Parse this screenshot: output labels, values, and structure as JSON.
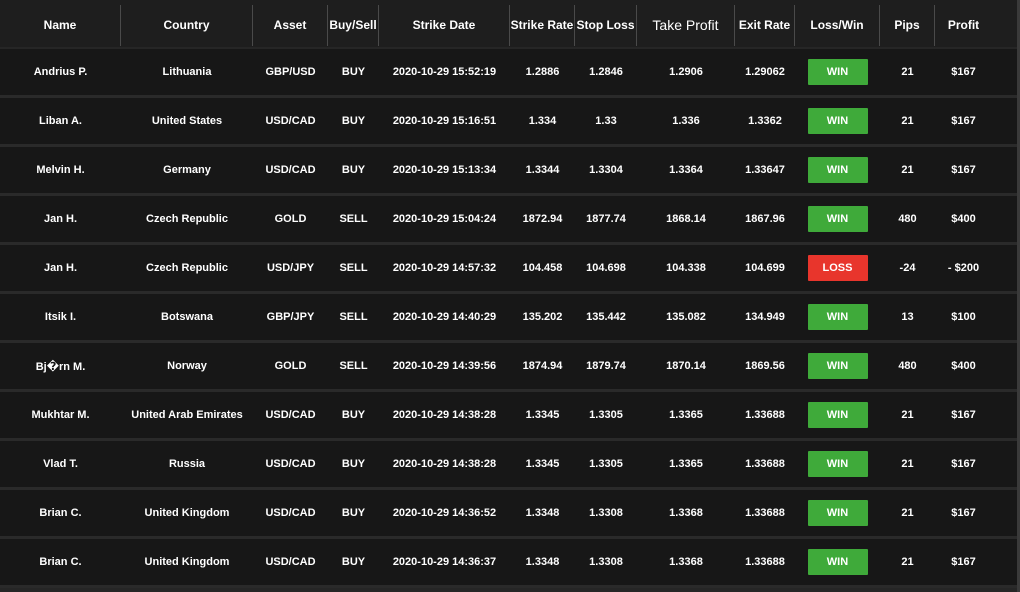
{
  "colors": {
    "win": "#3faa3a",
    "loss": "#e8352c",
    "background": "#171717",
    "header": "#1e1e1e"
  },
  "columns": [
    "Name",
    "Country",
    "Asset",
    "Buy/Sell",
    "Strike Date",
    "Strike Rate",
    "Stop Loss",
    "Take Profit",
    "Exit Rate",
    "Loss/Win",
    "Pips",
    "Profit"
  ],
  "rows": [
    {
      "name": "Andrius P.",
      "country": "Lithuania",
      "asset": "GBP/USD",
      "side": "BUY",
      "date": "2020-10-29 15:52:19",
      "strike": "1.2886",
      "stop": "1.2846",
      "take": "1.2906",
      "exit": "1.29062",
      "result": "WIN",
      "pips": "21",
      "profit": "$167"
    },
    {
      "name": "Liban A.",
      "country": "United States",
      "asset": "USD/CAD",
      "side": "BUY",
      "date": "2020-10-29 15:16:51",
      "strike": "1.334",
      "stop": "1.33",
      "take": "1.336",
      "exit": "1.3362",
      "result": "WIN",
      "pips": "21",
      "profit": "$167"
    },
    {
      "name": "Melvin H.",
      "country": "Germany",
      "asset": "USD/CAD",
      "side": "BUY",
      "date": "2020-10-29 15:13:34",
      "strike": "1.3344",
      "stop": "1.3304",
      "take": "1.3364",
      "exit": "1.33647",
      "result": "WIN",
      "pips": "21",
      "profit": "$167"
    },
    {
      "name": "Jan H.",
      "country": "Czech Republic",
      "asset": "GOLD",
      "side": "SELL",
      "date": "2020-10-29 15:04:24",
      "strike": "1872.94",
      "stop": "1877.74",
      "take": "1868.14",
      "exit": "1867.96",
      "result": "WIN",
      "pips": "480",
      "profit": "$400"
    },
    {
      "name": "Jan H.",
      "country": "Czech Republic",
      "asset": "USD/JPY",
      "side": "SELL",
      "date": "2020-10-29 14:57:32",
      "strike": "104.458",
      "stop": "104.698",
      "take": "104.338",
      "exit": "104.699",
      "result": "LOSS",
      "pips": "-24",
      "profit": "- $200"
    },
    {
      "name": "Itsik I.",
      "country": "Botswana",
      "asset": "GBP/JPY",
      "side": "SELL",
      "date": "2020-10-29 14:40:29",
      "strike": "135.202",
      "stop": "135.442",
      "take": "135.082",
      "exit": "134.949",
      "result": "WIN",
      "pips": "13",
      "profit": "$100"
    },
    {
      "name": "Bj�rn M.",
      "country": "Norway",
      "asset": "GOLD",
      "side": "SELL",
      "date": "2020-10-29 14:39:56",
      "strike": "1874.94",
      "stop": "1879.74",
      "take": "1870.14",
      "exit": "1869.56",
      "result": "WIN",
      "pips": "480",
      "profit": "$400"
    },
    {
      "name": "Mukhtar M.",
      "country": "United Arab Emirates",
      "asset": "USD/CAD",
      "side": "BUY",
      "date": "2020-10-29 14:38:28",
      "strike": "1.3345",
      "stop": "1.3305",
      "take": "1.3365",
      "exit": "1.33688",
      "result": "WIN",
      "pips": "21",
      "profit": "$167"
    },
    {
      "name": "Vlad T.",
      "country": "Russia",
      "asset": "USD/CAD",
      "side": "BUY",
      "date": "2020-10-29 14:38:28",
      "strike": "1.3345",
      "stop": "1.3305",
      "take": "1.3365",
      "exit": "1.33688",
      "result": "WIN",
      "pips": "21",
      "profit": "$167"
    },
    {
      "name": "Brian C.",
      "country": "United Kingdom",
      "asset": "USD/CAD",
      "side": "BUY",
      "date": "2020-10-29 14:36:52",
      "strike": "1.3348",
      "stop": "1.3308",
      "take": "1.3368",
      "exit": "1.33688",
      "result": "WIN",
      "pips": "21",
      "profit": "$167"
    },
    {
      "name": "Brian C.",
      "country": "United Kingdom",
      "asset": "USD/CAD",
      "side": "BUY",
      "date": "2020-10-29 14:36:37",
      "strike": "1.3348",
      "stop": "1.3308",
      "take": "1.3368",
      "exit": "1.33688",
      "result": "WIN",
      "pips": "21",
      "profit": "$167"
    }
  ]
}
